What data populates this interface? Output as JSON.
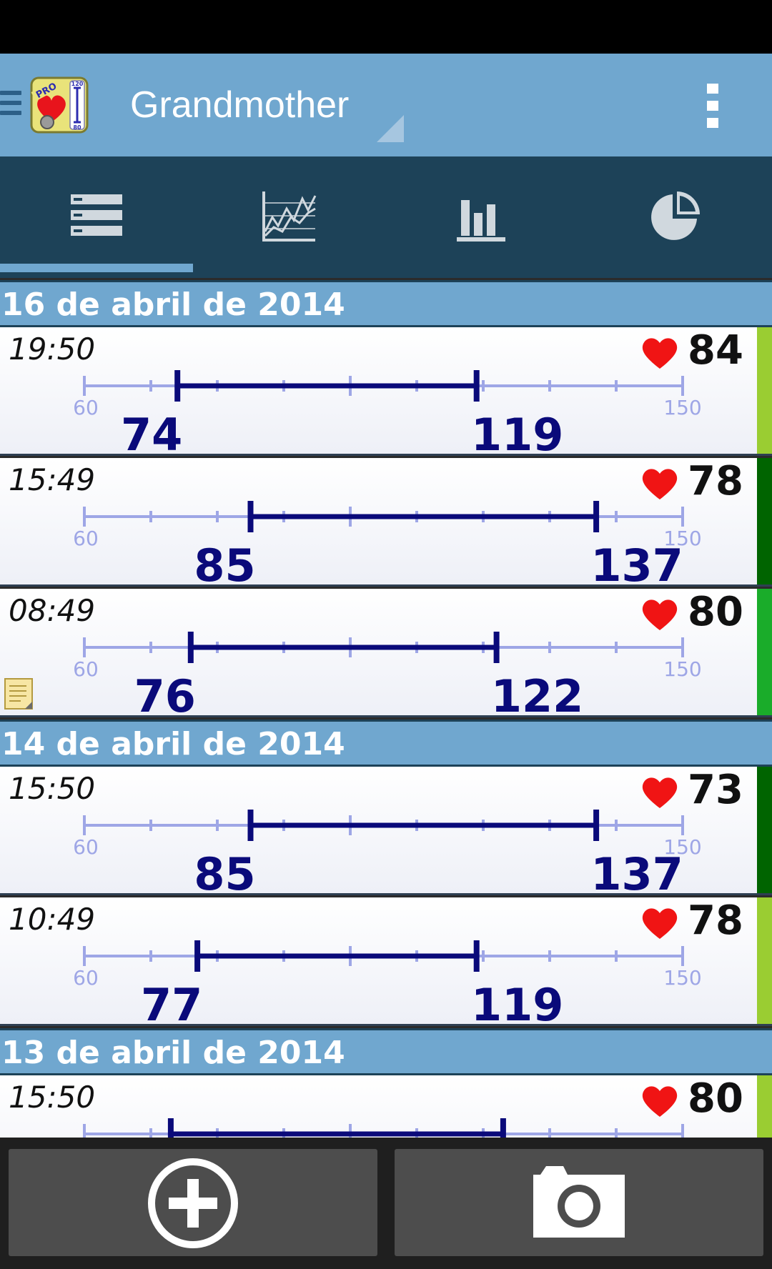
{
  "header": {
    "title": "Grandmother",
    "logo_text": "PRO",
    "logo_top": "120",
    "logo_bottom": "80"
  },
  "tabs": [
    {
      "id": "list",
      "icon": "list-icon",
      "selected": true
    },
    {
      "id": "line-chart",
      "icon": "line-chart-icon",
      "selected": false
    },
    {
      "id": "bar-chart",
      "icon": "bar-chart-icon",
      "selected": false
    },
    {
      "id": "pie-chart",
      "icon": "pie-chart-icon",
      "selected": false
    }
  ],
  "scale": {
    "min_label": "60",
    "max_label": "150",
    "min": 60,
    "max": 150
  },
  "groups": [
    {
      "date": "16 de abril de 2014",
      "entries": [
        {
          "time": "19:50",
          "pulse": "84",
          "diastolic": "74",
          "systolic": "119",
          "status_color": "#9acd32",
          "note": false
        },
        {
          "time": "15:49",
          "pulse": "78",
          "diastolic": "85",
          "systolic": "137",
          "status_color": "#006400",
          "note": false
        },
        {
          "time": "08:49",
          "pulse": "80",
          "diastolic": "76",
          "systolic": "122",
          "status_color": "#1aac2a",
          "note": true
        }
      ]
    },
    {
      "date": "14 de abril de 2014",
      "entries": [
        {
          "time": "15:50",
          "pulse": "73",
          "diastolic": "85",
          "systolic": "137",
          "status_color": "#006400",
          "note": false
        },
        {
          "time": "10:49",
          "pulse": "78",
          "diastolic": "77",
          "systolic": "119",
          "status_color": "#9acd32",
          "note": false
        }
      ]
    },
    {
      "date": "13 de abril de 2014",
      "entries": [
        {
          "time": "15:50",
          "pulse": "80",
          "diastolic": "73",
          "systolic": "123",
          "status_color": "#9acd32",
          "note": false
        }
      ]
    }
  ],
  "colors": {
    "action_bar": "#70a7cf",
    "tab_bar": "#1d4258",
    "scale_line": "#9ea6e6",
    "range_bar": "#0a0a7a",
    "heart": "#f01414"
  },
  "bottom_buttons": [
    {
      "id": "add",
      "icon": "add-circle-icon"
    },
    {
      "id": "camera",
      "icon": "camera-icon"
    }
  ]
}
